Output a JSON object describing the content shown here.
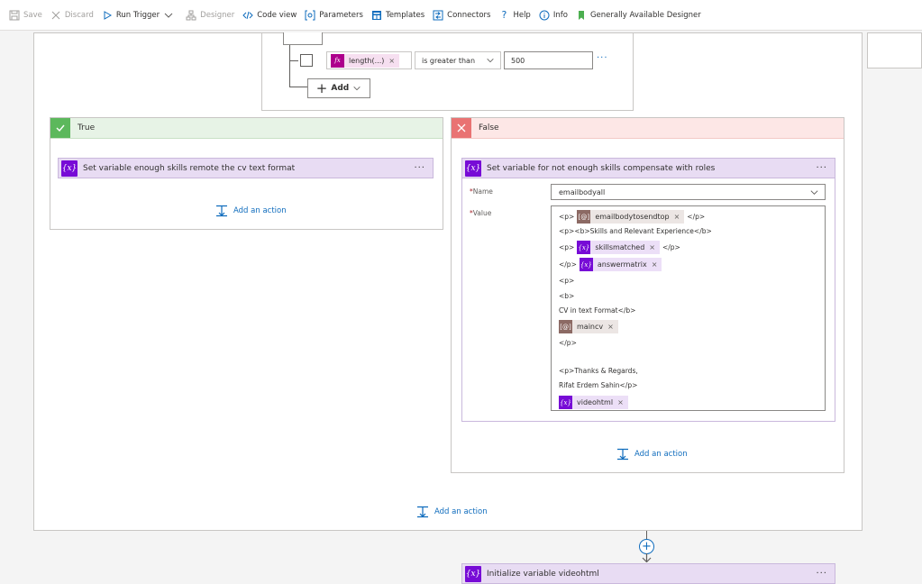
{
  "toolbar": {
    "save": "Save",
    "discard": "Discard",
    "run_trigger": "Run Trigger",
    "designer": "Designer",
    "code_view": "Code view",
    "parameters": "Parameters",
    "templates": "Templates",
    "connectors": "Connectors",
    "help": "Help",
    "info": "Info",
    "ga_designer": "Generally Available Designer"
  },
  "condition": {
    "expression_token": "length(...)",
    "operator": "is greater than",
    "value": "500",
    "add_label": "Add"
  },
  "true_branch": {
    "label": "True",
    "action_title": "Set variable enough skills remote the cv text format",
    "add_action": "Add an action"
  },
  "false_branch": {
    "label": "False",
    "action_title": "Set variable for not enough skills compensate with roles",
    "name_label": "Name",
    "name_value": "emailbodyall",
    "value_label": "Value",
    "value_lines": {
      "l1_pre": "<p>",
      "l1_token": "emailbodytosendtop",
      "l1_post": "</p>",
      "l2": "<p><b>Skills and Relevant Experience</b>",
      "l3_pre": "<p>",
      "l3_token": "skillsmatched",
      "l3_post": "</p>",
      "l4_pre": "</p>",
      "l4_token": "answermatrix",
      "l5": "<p>",
      "l6": "<b>",
      "l7": "CV in text Format</b>",
      "l8_token": "maincv",
      "l9": "</p>",
      "l10": "<p>Thanks & Regards,",
      "l11": "Rifat Erdem Sahin</p>",
      "l12_token": "videohtml"
    },
    "add_action": "Add an action"
  },
  "outer_add_action": "Add an action",
  "next_step_title": "Initialize variable videohtml",
  "token_close": "×",
  "colors": {
    "accent": "#0f6cbd",
    "variable_purple": "#770bd6",
    "true_green": "#5cb85c",
    "false_red": "#e97373"
  }
}
